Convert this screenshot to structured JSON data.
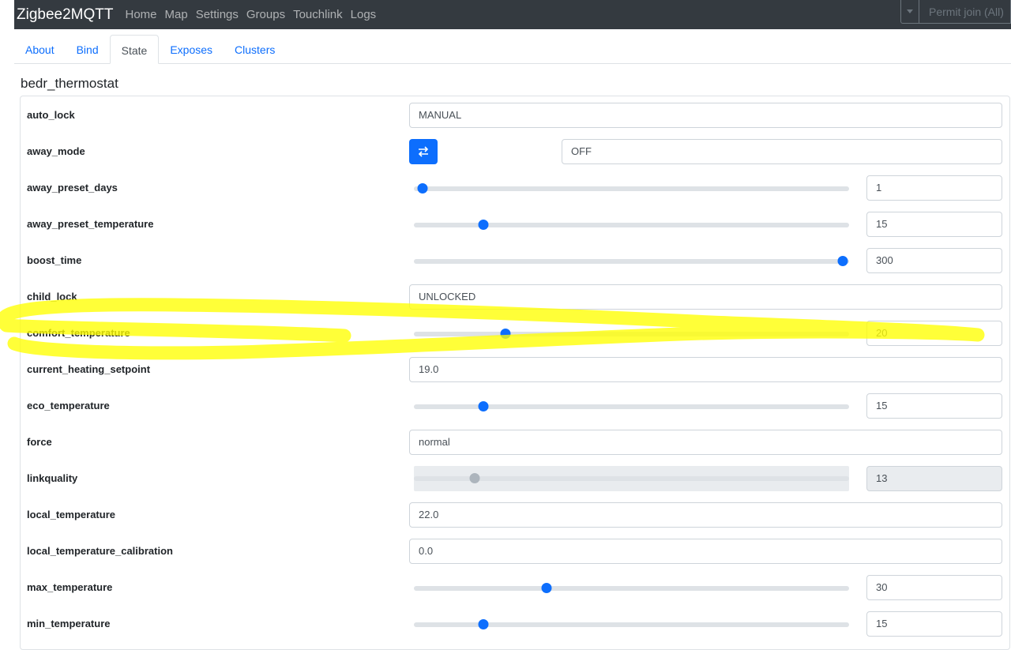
{
  "app": {
    "brand": "Zigbee2MQTT",
    "nav": [
      "Home",
      "Map",
      "Settings",
      "Groups",
      "Touchlink",
      "Logs"
    ],
    "permit_join": "Permit join (All)"
  },
  "tabs": [
    {
      "label": "About",
      "active": false
    },
    {
      "label": "Bind",
      "active": false
    },
    {
      "label": "State",
      "active": true
    },
    {
      "label": "Exposes",
      "active": false
    },
    {
      "label": "Clusters",
      "active": false
    }
  ],
  "device": {
    "name": "bedr_thermostat"
  },
  "icons": {
    "toggle": "swap-arrows-icon",
    "permit_dropdown": "caret-down-icon"
  },
  "colors": {
    "accent": "#0d6efd",
    "navbar": "#343a40",
    "highlight": "#ffff00"
  },
  "rows": [
    {
      "name": "auto_lock",
      "type": "text",
      "value": "MANUAL"
    },
    {
      "name": "away_mode",
      "type": "toggle",
      "value": "OFF"
    },
    {
      "name": "away_preset_days",
      "type": "slider",
      "value": "1",
      "fraction": 0.02
    },
    {
      "name": "away_preset_temperature",
      "type": "slider",
      "value": "15",
      "fraction": 0.16
    },
    {
      "name": "boost_time",
      "type": "slider",
      "value": "300",
      "fraction": 0.985
    },
    {
      "name": "child_lock",
      "type": "text",
      "value": "UNLOCKED"
    },
    {
      "name": "comfort_temperature",
      "type": "slider",
      "value": "20",
      "fraction": 0.21
    },
    {
      "name": "current_heating_setpoint",
      "type": "text",
      "value": "19.0"
    },
    {
      "name": "eco_temperature",
      "type": "slider",
      "value": "15",
      "fraction": 0.16
    },
    {
      "name": "force",
      "type": "text",
      "value": "normal"
    },
    {
      "name": "linkquality",
      "type": "slider-disabled",
      "value": "13",
      "fraction": 0.14
    },
    {
      "name": "local_temperature",
      "type": "text",
      "value": "22.0"
    },
    {
      "name": "local_temperature_calibration",
      "type": "text",
      "value": "0.0"
    },
    {
      "name": "max_temperature",
      "type": "slider",
      "value": "30",
      "fraction": 0.305
    },
    {
      "name": "min_temperature",
      "type": "slider",
      "value": "15",
      "fraction": 0.16
    }
  ]
}
